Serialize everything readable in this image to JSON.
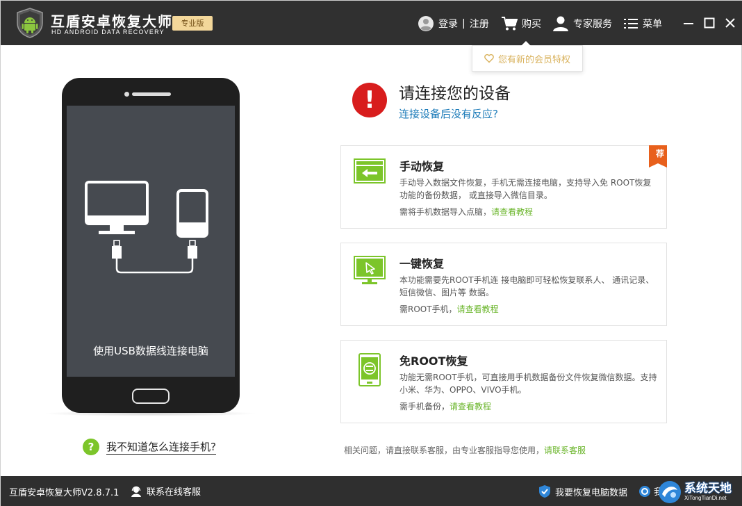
{
  "titlebar": {
    "app_title": "互盾安卓恢复大师",
    "app_subtitle": "HD ANDROID DATA RECOVERY",
    "edition_badge": "专业版",
    "login_label": "登录",
    "divider": "|",
    "register_label": "注册",
    "buy_label": "购买",
    "expert_label": "专家服务",
    "menu_label": "菜单",
    "icons": [
      "android-shield-logo-icon",
      "user-avatar-icon",
      "cart-icon",
      "person-icon",
      "list-menu-icon",
      "minimize-icon",
      "maximize-icon",
      "close-icon"
    ]
  },
  "vip_tip": {
    "text": "您有新的会员特权",
    "icon": "heart-icon",
    "color": "#d9b25c"
  },
  "phone": {
    "screen_text": "使用USB数据线连接电脑"
  },
  "help_connect": {
    "icon_text": "?",
    "text": "我不知道怎么连接手机?"
  },
  "connect_prompt": {
    "alert_icon_text": "!",
    "title": "请连接您的设备",
    "link": "连接设备后没有反应?"
  },
  "cards": [
    {
      "title": "手动恢复",
      "desc": "手动导入数据文件恢复，手机无需连接电脑，支持导入免 ROOT恢复功能的备份数据， 或直接导入微信目录。",
      "note": "需将手机数据导入点脑，",
      "link": "请查看教程",
      "badge": "荐",
      "icon": "import-arrow-icon"
    },
    {
      "title": "一键恢复",
      "desc": "本功能需要先ROOT手机连 接电脑即可轻松恢复联系人、 通讯记录、短信微信、图片等 数据。",
      "note": "需ROOT手机，",
      "link": "请查看教程",
      "icon": "monitor-cursor-icon"
    },
    {
      "title": "免ROOT恢复",
      "desc": "功能无需ROOT手机，可直接用手机数据备份文件恢复微信数据。支持小米、华为、OPPO、VIVO手机。",
      "note": "需手机备份，",
      "link": "请查看教程",
      "icon": "phone-backup-icon"
    }
  ],
  "contact": {
    "text": "相关问题，请直接联系客服，由专业客服指导您使用，",
    "link": "请联系客服"
  },
  "statusbar": {
    "version": "互盾安卓恢复大师V2.8.7.1",
    "online_service": "联系在线客服",
    "pc_recover": "我要恢复电脑数据",
    "extra_text": "我"
  },
  "watermark": {
    "main": "系统天地",
    "sub": "XiTongTianDi.net"
  },
  "colors": {
    "titlebar": "#303030",
    "accent_green": "#7cc52a",
    "link_blue": "#1a7ab8",
    "alert_red": "#d81d1d",
    "badge_orange": "#e8601c"
  }
}
